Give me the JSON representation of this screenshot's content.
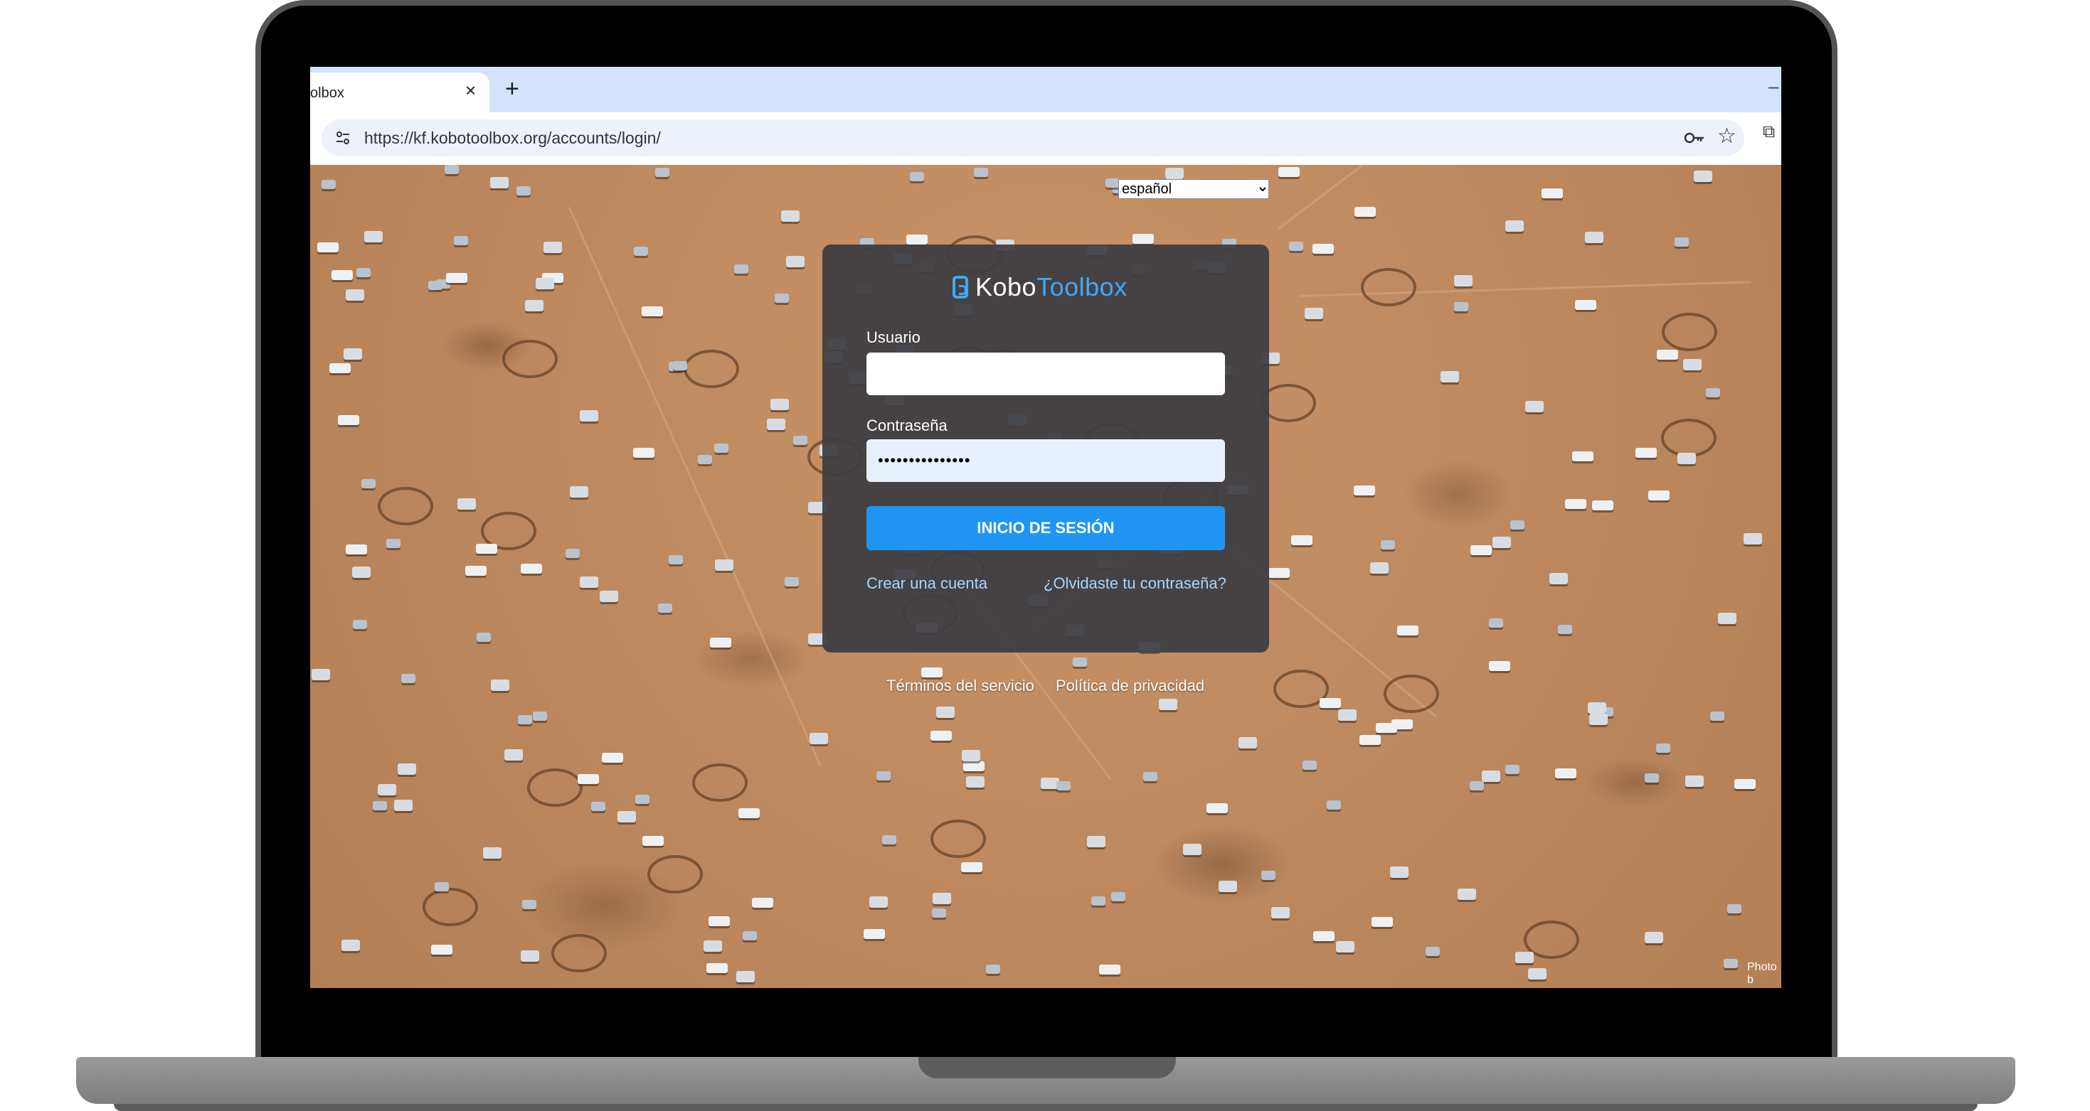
{
  "browser": {
    "tab_title": "olbox",
    "tab_close": "×",
    "new_tab": "+",
    "minimize": "–",
    "url": "https://kf.kobotoolbox.org/accounts/login/",
    "icons": [
      "site-settings-icon",
      "password-key-icon",
      "bookmark-star-icon",
      "extensions-icon"
    ]
  },
  "page": {
    "language": {
      "selected": "español"
    },
    "logo": {
      "part1": "Kobo",
      "part2": "Toolbox",
      "accent": "#3fa9f5"
    },
    "form": {
      "username_label": "Usuario",
      "username_value": "",
      "password_label": "Contraseña",
      "password_value": "•••••••••••••••",
      "submit_label": "INICIO DE SESIÓN",
      "create_account": "Crear una cuenta",
      "forgot_password": "¿Olvidaste tu contraseña?"
    },
    "footer": {
      "terms": "Términos del servicio",
      "privacy": "Política de privacidad"
    },
    "photo_credit": "Photo b",
    "colors": {
      "button": "#2095f3",
      "card": "#3c3c42",
      "link": "#a8d6ff"
    }
  }
}
